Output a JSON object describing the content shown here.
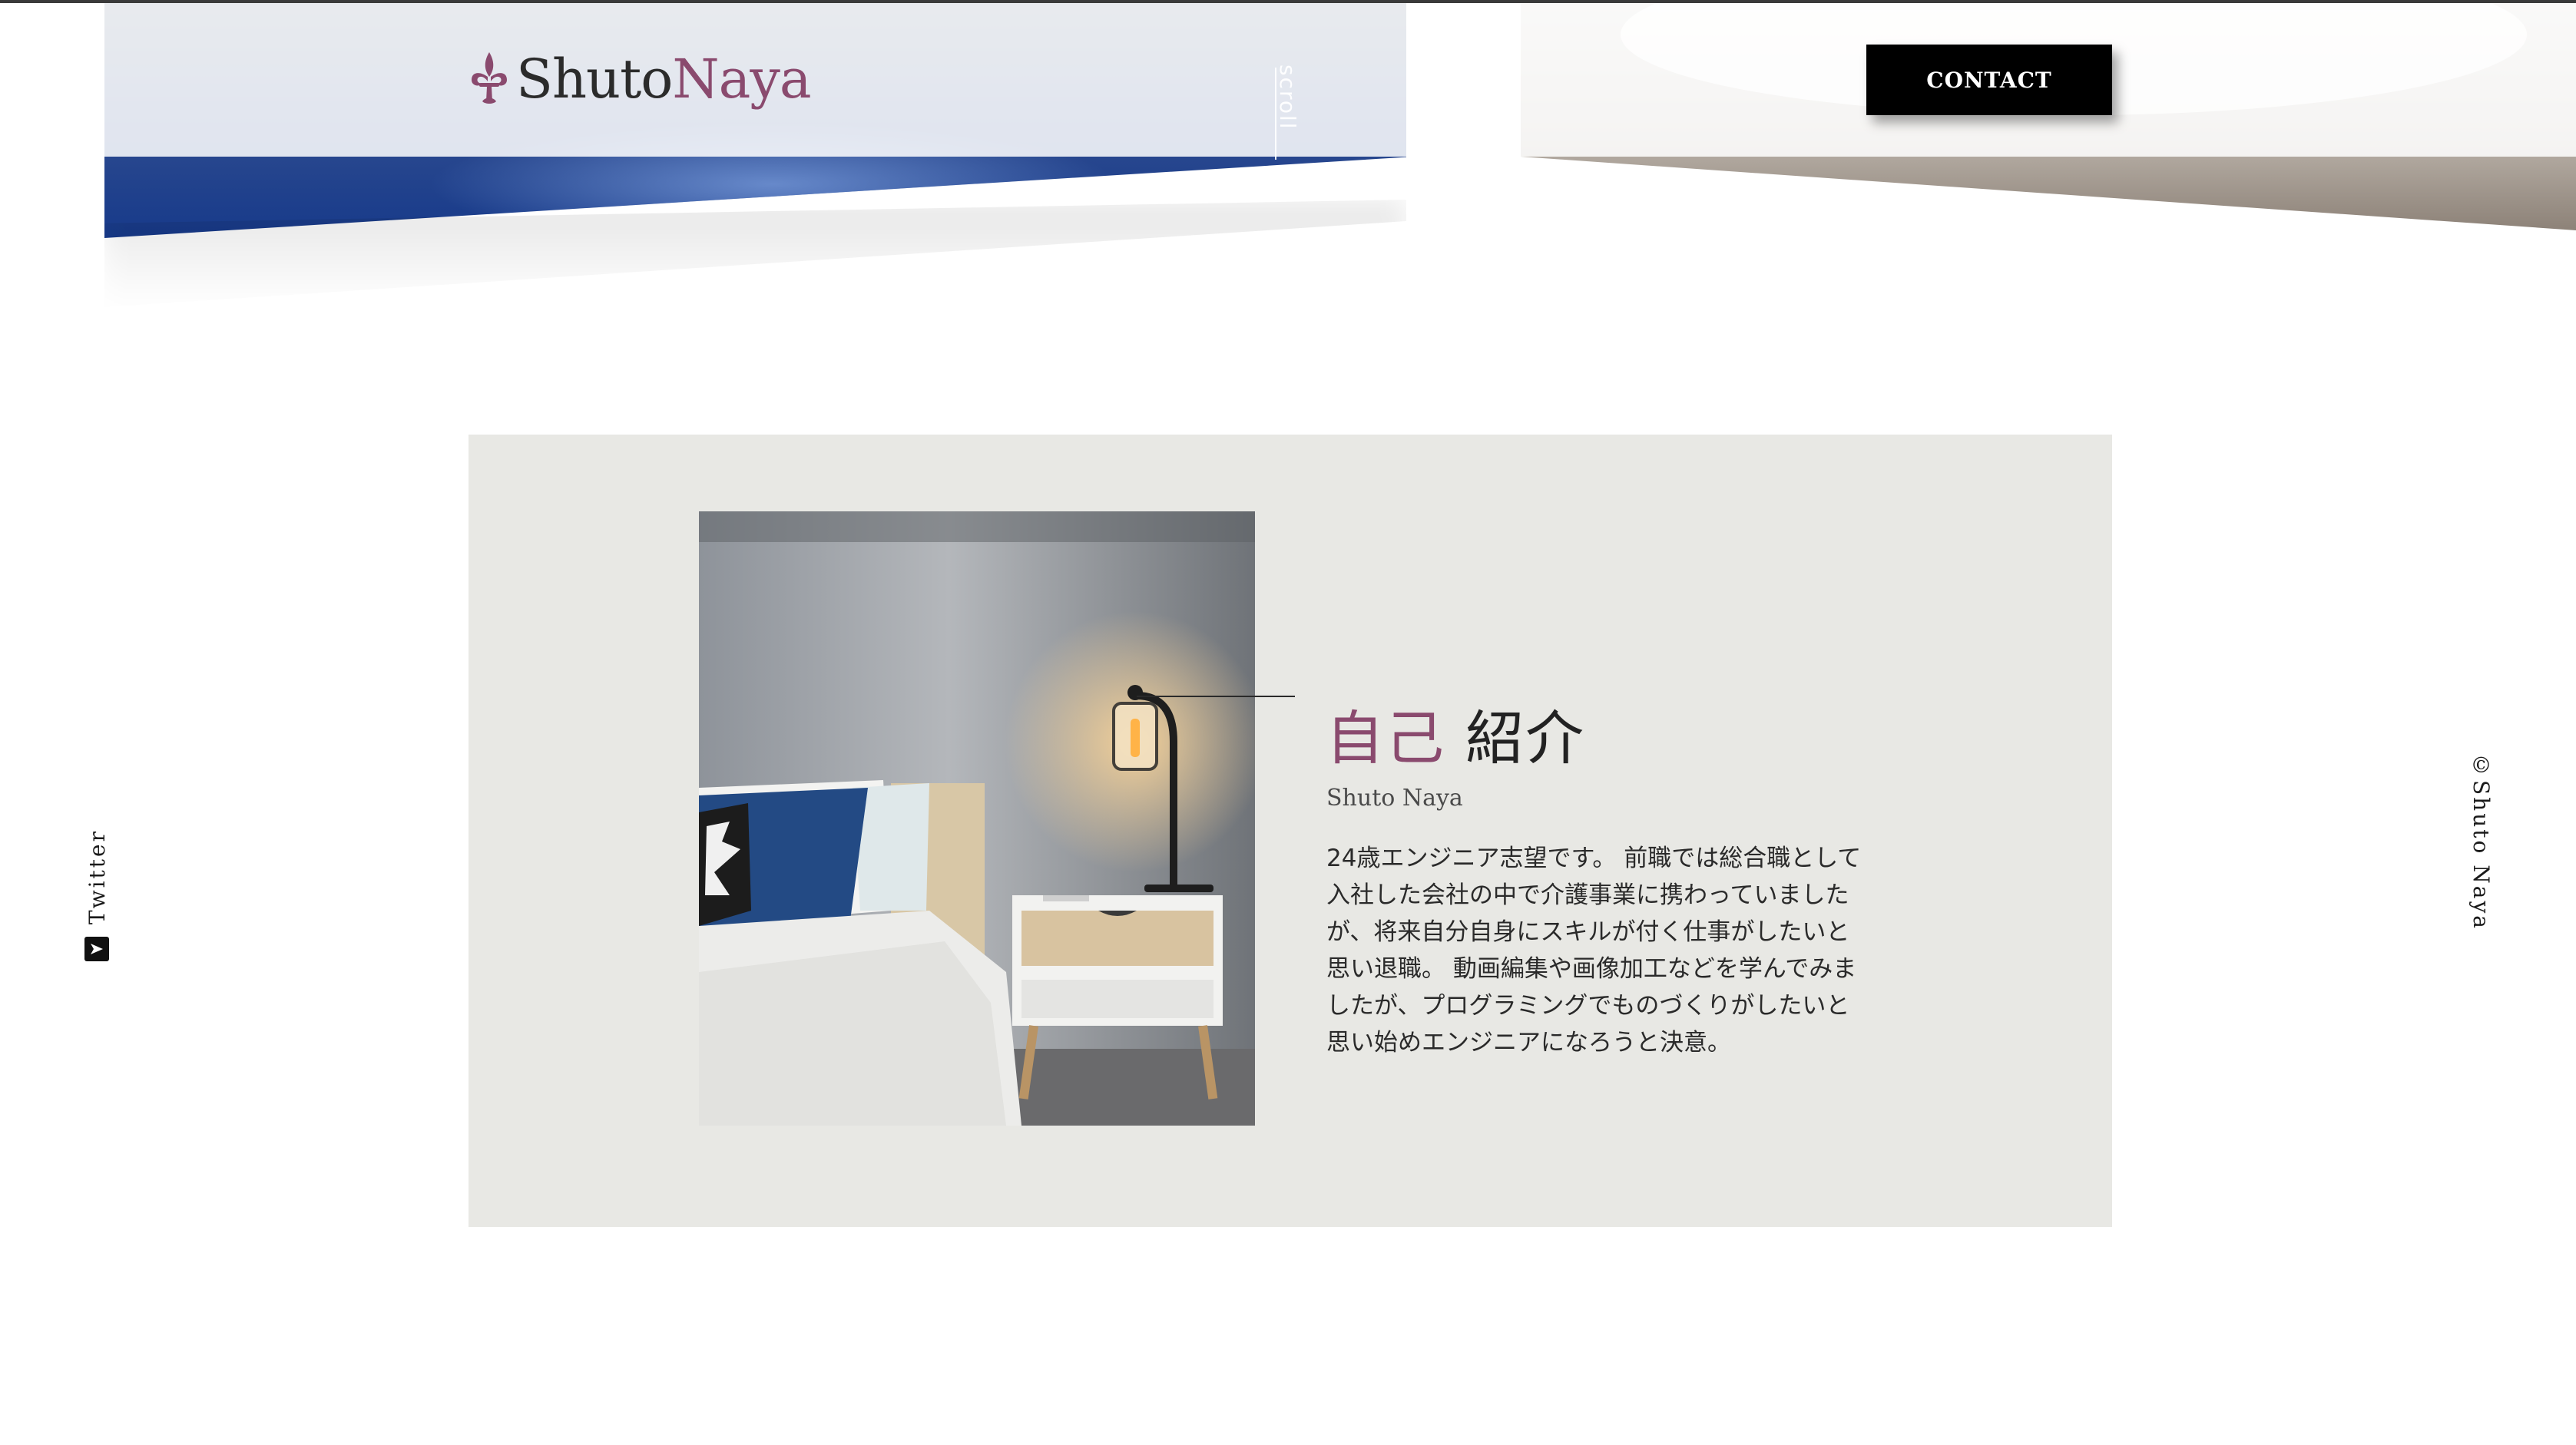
{
  "header": {
    "logo": {
      "part1": "Shuto",
      "part2": "Naya",
      "icon": "fleur-de-lis-icon"
    },
    "scroll_label": "scroll",
    "contact_label": "CONTACT"
  },
  "about": {
    "title_accent": "自己",
    "title_rest": "紹介",
    "name": "Shuto Naya",
    "paragraph_lines": [
      "24歳エンジニア志望です。 前職では総合職として",
      "入社した会社の中で介護事業に携わっていました",
      "が、将来自分自身にスキルが付く仕事がしたいと",
      "思い退職。 動画編集や画像加工などを学んでみま",
      "したが、プログラミングでものづくりがしたいと",
      "思い始めエンジニアになろうと決意。"
    ]
  },
  "side": {
    "twitter_label": "Twitter",
    "twitter_icon": "twitter-icon",
    "copyright": "©Shuto Naya"
  },
  "colors": {
    "accent": "#8a4a6e",
    "card_bg": "#e8e8e4",
    "button_bg": "#000000"
  }
}
